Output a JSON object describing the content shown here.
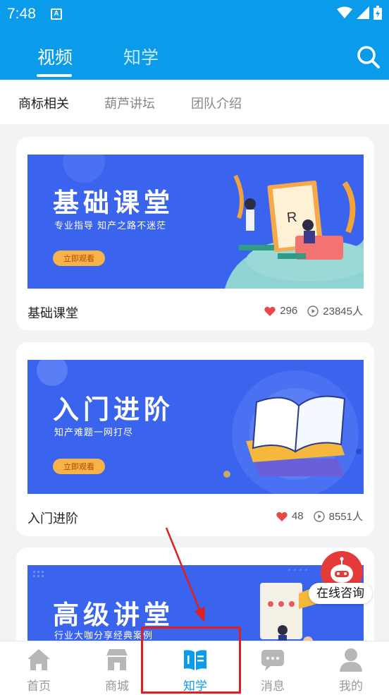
{
  "status_bar": {
    "time": "7:48",
    "badge": "A"
  },
  "header": {
    "tabs": [
      {
        "label": "视频",
        "active": true
      },
      {
        "label": "知学",
        "active": false
      }
    ],
    "search_icon": "search-icon"
  },
  "subnav": {
    "items": [
      "商标相关",
      "葫芦讲坛",
      "团队介绍"
    ],
    "selected": "商标相关"
  },
  "courses": [
    {
      "title": "基础课堂",
      "banner_heading": "基础课堂",
      "banner_subtitle": "专业指导 知产之路不迷茫",
      "banner_button": "立即观看",
      "likes": "296",
      "views": "23845人"
    },
    {
      "title": "入门进阶",
      "banner_heading": "入门进阶",
      "banner_subtitle": "知产难题一网打尽",
      "banner_button": "立即观看",
      "likes": "48",
      "views": "8551人"
    },
    {
      "banner_heading": "高级讲堂",
      "banner_subtitle": "行业大咖分享经典案例"
    }
  ],
  "consult": {
    "label": "在线咨询"
  },
  "bottom_nav": [
    {
      "label": "首页",
      "icon": "home-icon",
      "active": false
    },
    {
      "label": "商城",
      "icon": "shop-icon",
      "active": false
    },
    {
      "label": "知学",
      "icon": "book-icon",
      "active": true
    },
    {
      "label": "消息",
      "icon": "message-icon",
      "active": false
    },
    {
      "label": "我的",
      "icon": "user-icon",
      "active": false
    }
  ],
  "colors": {
    "brand": "#0a9bea",
    "banner_blue": "#3a63ee",
    "button_orange": "#f7b24a",
    "like_red": "#e8484a",
    "annotation_red": "#e02020"
  }
}
